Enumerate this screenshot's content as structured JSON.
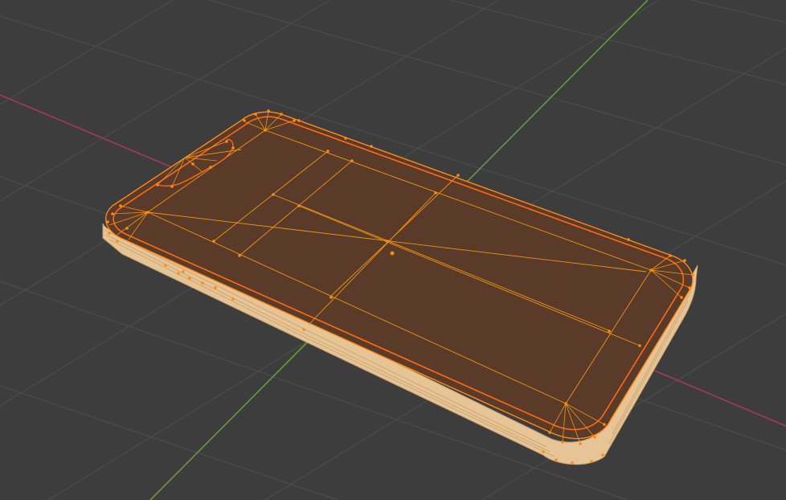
{
  "viewport": {
    "background": "#3d3d3d",
    "grid_color": "#4a4a4a",
    "x_axis_color": "#a63a4f",
    "y_axis_color": "#6a9a36"
  },
  "mesh": {
    "selected": true,
    "mode": "edit-mode",
    "face_fill": "#5a3a28",
    "side_fill": "#e3c08f",
    "edge_color": "#ff9e1a",
    "outline_color": "#ff6a14",
    "vertex_color": "#ff8a10"
  }
}
